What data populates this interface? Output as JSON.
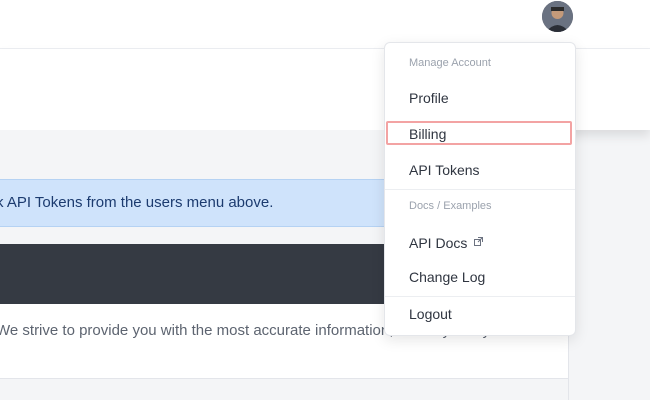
{
  "header": {
    "avatar_alt": "User avatar"
  },
  "alert": {
    "text": "k API Tokens from the users menu above."
  },
  "content": {
    "paragraph": "We strive to provide you with the most accurate information, if at anytime you"
  },
  "user_menu": {
    "sections": [
      {
        "title": "Manage Account",
        "items": [
          "Profile",
          "Billing",
          "API Tokens"
        ]
      },
      {
        "title": "Docs / Examples",
        "items": [
          "API Docs",
          "Change Log"
        ]
      }
    ],
    "logout": "Logout",
    "highlighted_item": "Billing"
  },
  "icons": {
    "external_link": "external-link-icon"
  },
  "colors": {
    "alert_bg": "#cfe3fb",
    "alert_text": "#1c3b6f",
    "dark_banner": "#353a43",
    "highlight_border": "#f3a3a3"
  }
}
